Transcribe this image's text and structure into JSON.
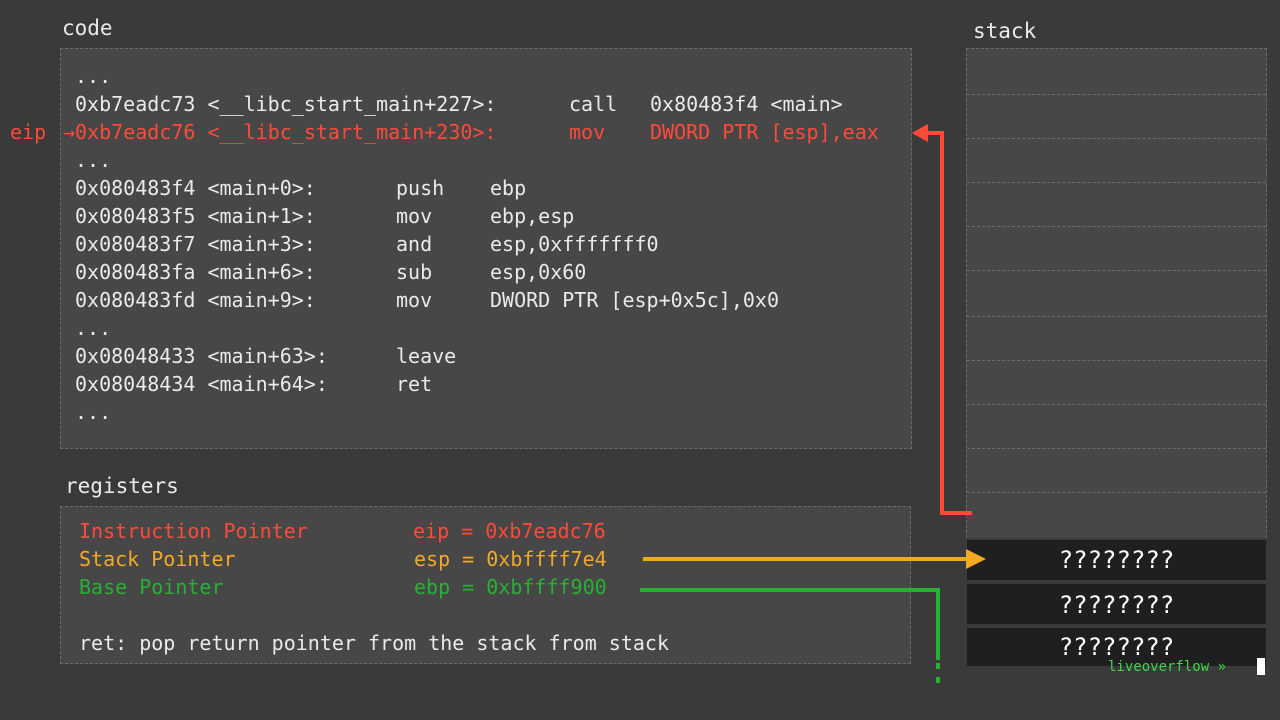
{
  "code": {
    "title": "code",
    "eip_label": "eip",
    "lines": [
      {
        "addr": "...",
        "mn": "",
        "op": "",
        "highlight": false
      },
      {
        "addr": "0xb7eadc73 <__libc_start_main+227>:",
        "mn": "call",
        "op": "0x80483f4 <main>",
        "highlight": false
      },
      {
        "addr": "→0xb7eadc76 <__libc_start_main+230>:",
        "mn": "mov",
        "op": "DWORD PTR [esp],eax",
        "highlight": true
      },
      {
        "addr": "...",
        "mn": "",
        "op": "",
        "highlight": false
      },
      {
        "addr": "0x080483f4 <main+0>:",
        "mn": "push",
        "op": "ebp",
        "highlight": false
      },
      {
        "addr": "0x080483f5 <main+1>:",
        "mn": "mov",
        "op": "ebp,esp",
        "highlight": false
      },
      {
        "addr": "0x080483f7 <main+3>:",
        "mn": "and",
        "op": "esp,0xfffffff0",
        "highlight": false
      },
      {
        "addr": "0x080483fa <main+6>:",
        "mn": "sub",
        "op": "esp,0x60",
        "highlight": false
      },
      {
        "addr": "0x080483fd <main+9>:",
        "mn": "mov",
        "op": "DWORD PTR [esp+0x5c],0x0",
        "highlight": false
      },
      {
        "addr": "...",
        "mn": "",
        "op": "",
        "highlight": false
      },
      {
        "addr": "0x08048433 <main+63>:",
        "mn": "leave",
        "op": "",
        "highlight": false
      },
      {
        "addr": "0x08048434 <main+64>:",
        "mn": "ret",
        "op": "",
        "highlight": false
      },
      {
        "addr": "...",
        "mn": "",
        "op": "",
        "highlight": false
      }
    ]
  },
  "registers": {
    "title": "registers",
    "eip": {
      "name": "Instruction Pointer",
      "value": "eip = 0xb7eadc76",
      "color": "#ff4a3a"
    },
    "esp": {
      "name": "Stack Pointer",
      "value": "esp = 0xbffff7e4",
      "color": "#f3a928"
    },
    "ebp": {
      "name": "Base Pointer",
      "value": "ebp = 0xbffff900",
      "color": "#25b233"
    },
    "note": "ret: pop return pointer from the stack from stack"
  },
  "stack": {
    "title": "stack",
    "filled_values": [
      "????????",
      "????????",
      "????????"
    ]
  },
  "watermark": "liveoverflow »"
}
